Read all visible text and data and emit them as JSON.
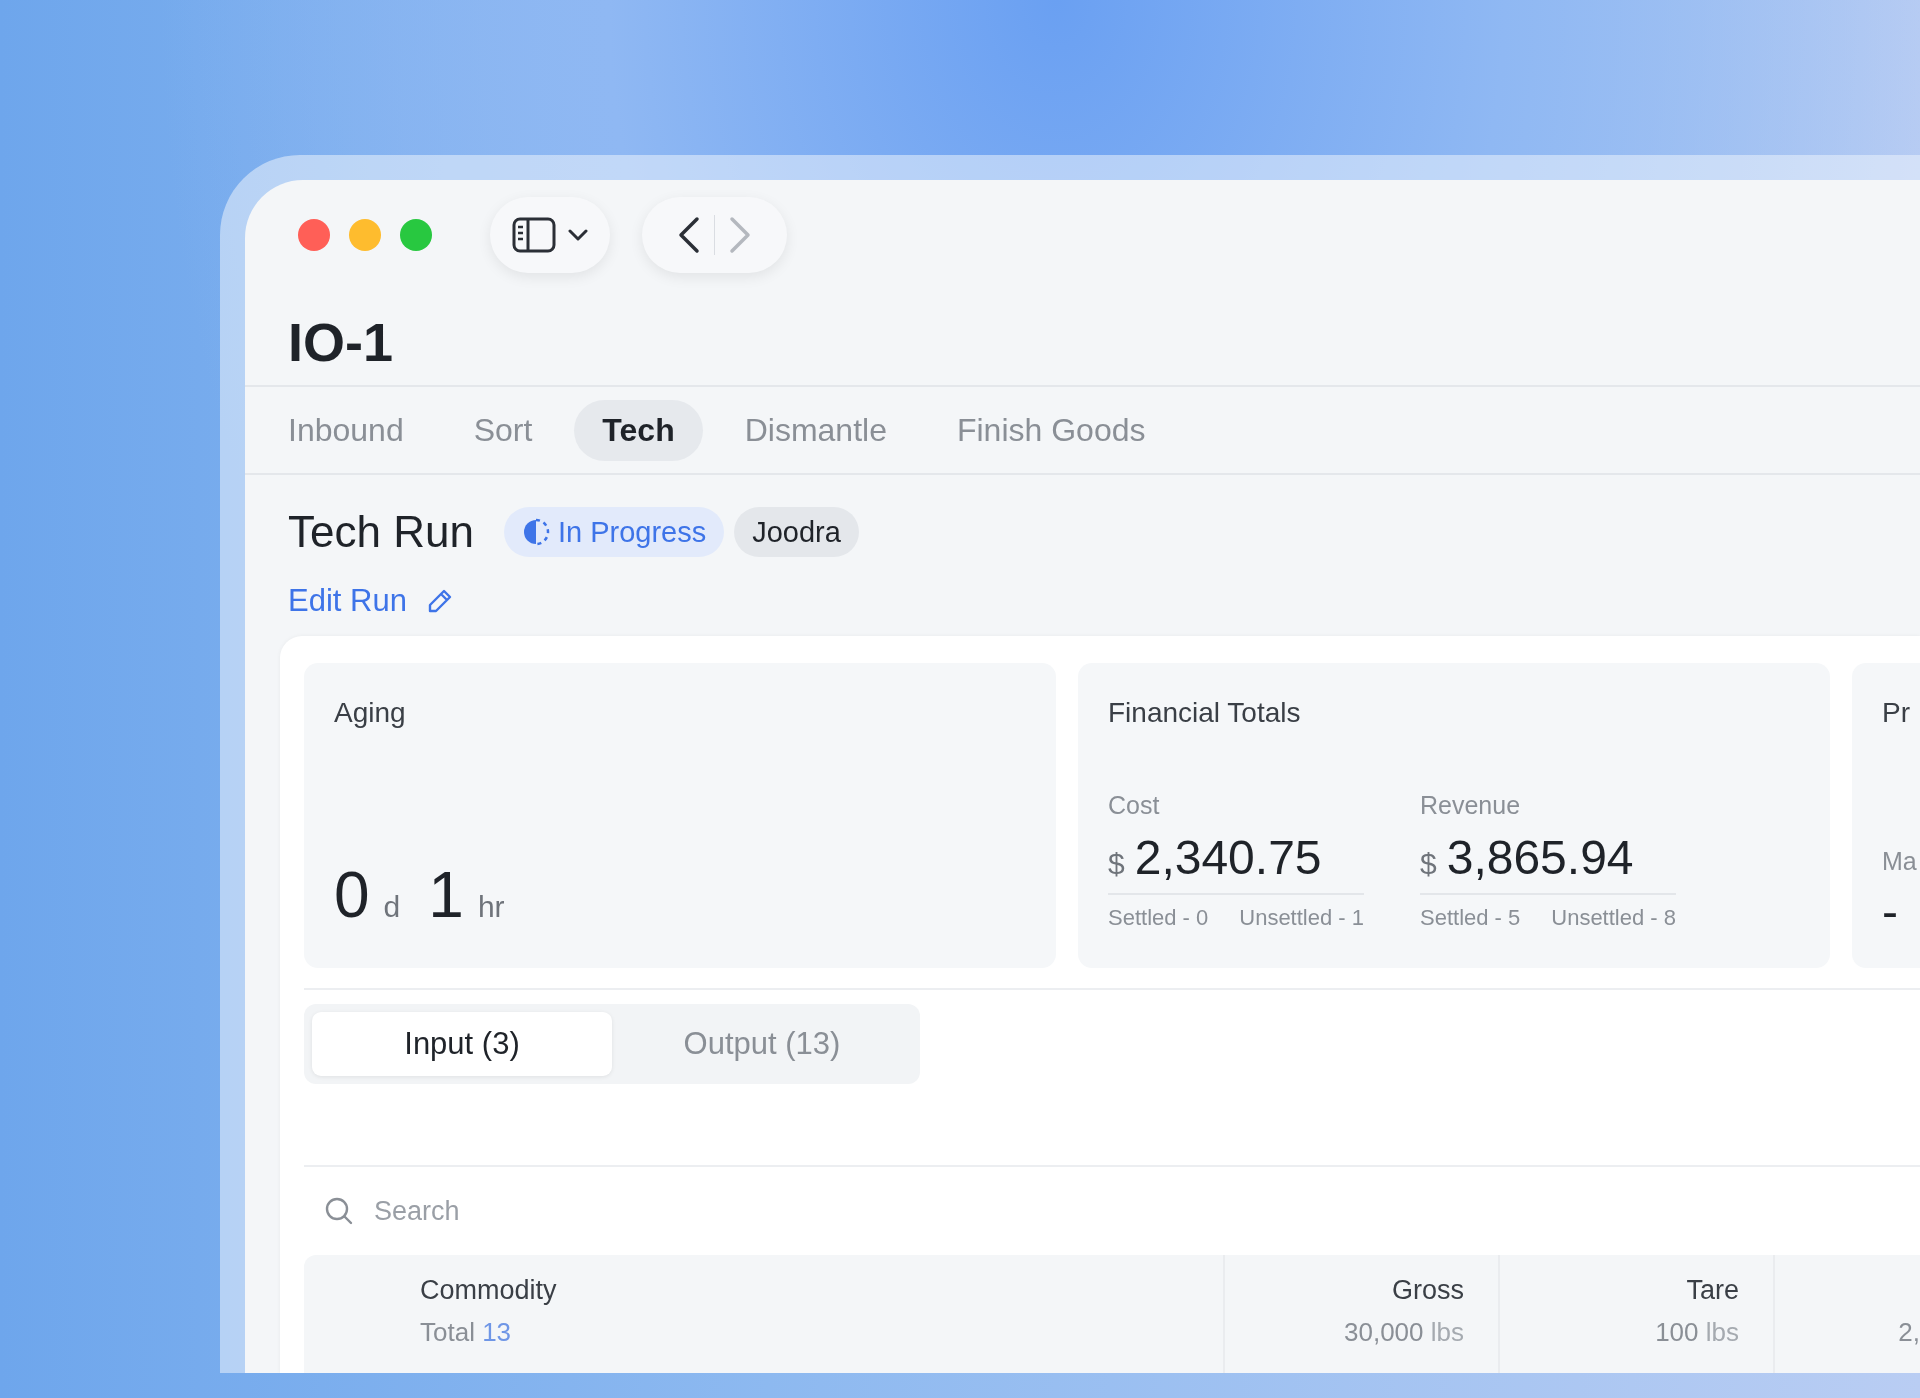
{
  "navigation": {
    "back_enabled": true,
    "forward_enabled": false
  },
  "title": "IO-1",
  "tabs": [
    {
      "label": "Inbound",
      "selected": false
    },
    {
      "label": "Sort",
      "selected": false
    },
    {
      "label": "Tech",
      "selected": true
    },
    {
      "label": "Dismantle",
      "selected": false
    },
    {
      "label": "Finish Goods",
      "selected": false
    }
  ],
  "run": {
    "title": "Tech Run",
    "status": "In Progress",
    "assignee": "Joodra",
    "edit_link": "Edit Run"
  },
  "aging": {
    "title": "Aging",
    "days": "0",
    "days_unit": "d",
    "hours": "1",
    "hours_unit": "hr"
  },
  "financial": {
    "title": "Financial Totals",
    "groups": [
      {
        "label": "Cost",
        "currency": "$",
        "amount": "2,340.75",
        "settled": "Settled - 0",
        "unsettled": "Unsettled - 1"
      },
      {
        "label": "Revenue",
        "currency": "$",
        "amount": "3,865.94",
        "settled": "Settled - 5",
        "unsettled": "Unsettled - 8"
      }
    ]
  },
  "card_3": {
    "title": "Pr",
    "label": "Ma",
    "value": "-"
  },
  "segments": [
    {
      "label": "Input (3)",
      "selected": true
    },
    {
      "label": "Output (13)",
      "selected": false
    }
  ],
  "search": {
    "placeholder": "Search"
  },
  "table": {
    "columns": [
      {
        "kind": "count",
        "header": "Commodity",
        "total_label": "Total",
        "total_value": "13"
      },
      {
        "kind": "weight",
        "header": "Gross",
        "total_value": "30,000",
        "unit": "lbs"
      },
      {
        "kind": "weight",
        "header": "Tare",
        "total_value": "100",
        "unit": "lbs"
      },
      {
        "kind": "weight",
        "total_value": "2,"
      }
    ]
  }
}
